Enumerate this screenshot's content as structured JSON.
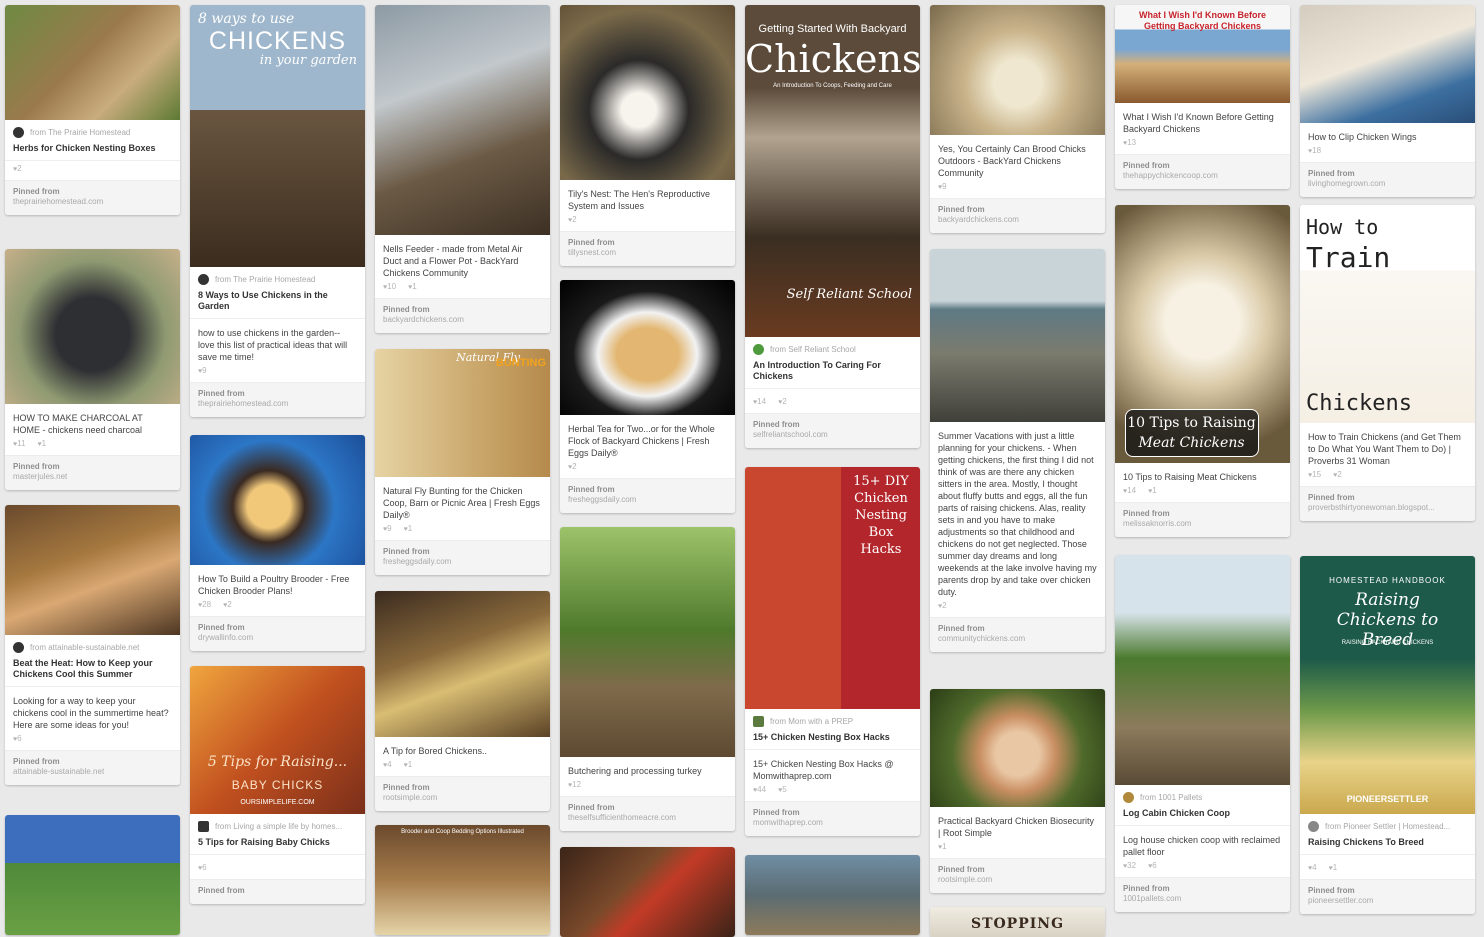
{
  "columns": [
    [
      {
        "h": 115,
        "bg": "linear-gradient(135deg,#6e8a43,#9a7a4c 45%,#c9ac7d 70%,#5d7a33)",
        "from": "from The Prairie Homestead",
        "title": "Herbs for Chicken Nesting Boxes",
        "counts": [
          "2"
        ],
        "pinned_label": "Pinned from",
        "pinned_site": "theprairiehomestead.com"
      },
      {
        "h": 155,
        "bg": "radial-gradient(circle at 50% 55%,#2d2f33 0 30%,#8f9a72 60%,#c6b08a 100%)",
        "desc": "HOW TO MAKE CHARCOAL AT HOME - chickens need charcoal",
        "counts": [
          "11",
          "1"
        ],
        "pinned_label": "Pinned from",
        "pinned_site": "masterjules.net"
      },
      {
        "h": 130,
        "bg": "linear-gradient(160deg,#6a4a2d,#a5783f 40%,#d9a873 60%,#4d3622)",
        "from": "from attainable-sustainable.net",
        "title": "Beat the Heat: How to Keep your Chickens Cool this Summer",
        "desc": "Looking for a way to keep your chickens cool in the summertime heat? Here are some ideas for you!",
        "counts": [
          "6"
        ],
        "pinned_label": "Pinned from",
        "pinned_site": "attainable-sustainable.net"
      },
      {
        "h": 120,
        "bg": "linear-gradient(180deg,#3c6ebd 0 40%,#4f8a3a 40%,#6aa044 100%)",
        "counts": []
      }
    ],
    [
      {
        "h": 260,
        "bg": "linear-gradient(180deg,#9fb7cc 0 40%,#6a5640 40%,#3b2c1e 100%)",
        "overlay": "8 ways to use",
        "overlay2": "CHICKENS",
        "overlay3": "in your garden",
        "from": "from The Prairie Homestead",
        "title": "8 Ways to Use Chickens in the Garden",
        "desc": "how to use chickens in the garden-- love this list of practical ideas that will save me time!",
        "counts": [
          "9"
        ],
        "pinned_label": "Pinned from",
        "pinned_site": "theprairiehomestead.com"
      },
      {
        "h": 130,
        "bg": "radial-gradient(circle at 45% 55%,#f1c87a 0 18%,#3a2a22 30%,#2c76c6 55%,#1c4f9a 100%)",
        "desc": "How To Build a Poultry Brooder - Free Chicken Brooder Plans!",
        "counts": [
          "28",
          "2"
        ],
        "pinned_label": "Pinned from",
        "pinned_site": "drywallinfo.com"
      },
      {
        "h": 148,
        "bg": "linear-gradient(135deg,#f0a63e,#c1501f 50%,#7a2f1a)",
        "overlay": "5 Tips for Raising...",
        "overlay2": "BABY CHICKS",
        "overlay3": "OURSIMPLELIFE.COM",
        "from": "from Living a simple life by homes...",
        "title": "5 Tips for Raising Baby Chicks",
        "counts": [
          "6"
        ],
        "pinned_label": "Pinned from",
        "pinned_site": ""
      }
    ],
    [
      {
        "h": 230,
        "bg": "linear-gradient(160deg,#8d9aa4,#c2c8cc 35%,#6b5a45 65%,#3d3024)",
        "desc": "Nells Feeder - made from Metal Air Duct and a Flower Pot - BackYard Chickens Community",
        "counts": [
          "10",
          "1"
        ],
        "pinned_label": "Pinned from",
        "pinned_site": "backyardchickens.com"
      },
      {
        "h": 128,
        "bg": "linear-gradient(90deg,#e6d3a3,#c9a66a 60%,#b58a4c)",
        "overlay": "Natural Fly",
        "overlay2": "BUNTING",
        "desc": "Natural Fly Bunting for the Chicken Coop, Barn or Picnic Area | Fresh Eggs Daily®",
        "counts": [
          "9",
          "1"
        ],
        "pinned_label": "Pinned from",
        "pinned_site": "fresheggsdaily.com"
      },
      {
        "h": 146,
        "bg": "linear-gradient(160deg,#3b2b1f,#8a6a3c 40%,#d8bd73 60%,#5b4226)",
        "desc": "A Tip for Bored Chickens..",
        "counts": [
          "4",
          "1"
        ],
        "pinned_label": "Pinned from",
        "pinned_site": "rootsimple.com"
      },
      {
        "h": 110,
        "bg": "linear-gradient(180deg,#6b4a2d,#a57b4a 50%,#e5d4a8)",
        "overlay": "Brooder and Coop Bedding Options Illustrated",
        "counts": []
      }
    ],
    [
      {
        "h": 175,
        "bg": "radial-gradient(circle at 45% 60%,#f7f4ee 0 12%,#2b2a29 35%,#7a6a4a 70%,#5d4a32)",
        "desc": "Tily's Nest: The Hen's Reproductive System and Issues",
        "counts": [
          "2"
        ],
        "pinned_label": "Pinned from",
        "pinned_site": "tillysnest.com"
      },
      {
        "h": 135,
        "bg": "radial-gradient(ellipse at 50% 55%,#e3b772 0 25%,#f2f2f2 40%,#1a1a1a 60%,#000)",
        "desc": "Herbal Tea for Two...or for the Whole Flock of Backyard Chickens | Fresh Eggs Daily®",
        "counts": [
          "2"
        ],
        "pinned_label": "Pinned from",
        "pinned_site": "fresheggsdaily.com"
      },
      {
        "h": 230,
        "bg": "linear-gradient(180deg,#9dc36a,#4f7a2c 45%,#7f6a4b 70%,#5d4a31)",
        "desc": "Butchering and processing turkey",
        "counts": [
          "12"
        ],
        "pinned_label": "Pinned from",
        "pinned_site": "theselfsufficienthomeacre.com"
      },
      {
        "h": 90,
        "bg": "linear-gradient(135deg,#3a2418,#7a4a2b 40%,#c23b26 55%,#3a2418)",
        "counts": []
      }
    ],
    [
      {
        "h": 330,
        "bg": "linear-gradient(180deg,#5c4b3a 0 25%,#b2a390 40%,#3a2e22 70%,#6a3b20)",
        "overlay": "Getting Started With Backyard",
        "overlay2": "Chickens",
        "overlay3": "An Introduction To Coops, Feeding and Care",
        "overlay4": "Self Reliant School",
        "from": "from Self Reliant School",
        "title": "An Introduction To Caring For Chickens",
        "counts": [
          "14",
          "2"
        ],
        "pinned_label": "Pinned from",
        "pinned_site": "selfreliantschool.com"
      },
      {
        "h": 240,
        "bg": "linear-gradient(90deg,#c9462f 0 55%,#b3262b 55%),linear-gradient(180deg,#e0e0e0,#c2a98b)",
        "overlay": "15+ DIY Chicken Nesting Box Hacks",
        "from": "from Mom with a PREP",
        "title": "15+ Chicken Nesting Box Hacks",
        "desc": "15+ Chicken Nesting Box Hacks @ Momwithaprep.com",
        "counts": [
          "44",
          "5"
        ],
        "pinned_label": "Pinned from",
        "pinned_site": "momwithaprep.com"
      },
      {
        "h": 80,
        "bg": "linear-gradient(180deg,#6f8ea4,#5b6c72 50%,#8d7a5b)",
        "counts": []
      }
    ],
    [
      {
        "h": 100,
        "bg": "radial-gradient(circle at 50% 60%,#efe7cf 0 20%,#c9b48b 45%,#7a6a4c 100%)",
        "desc": "Yes, You Certainly Can Brood Chicks Outdoors - BackYard Chickens Community",
        "counts": [
          "9"
        ],
        "pinned_label": "Pinned from",
        "pinned_site": "backyardchickens.com"
      },
      {
        "h": 173,
        "bg": "linear-gradient(180deg,#c9d4d8 0 30%,#5e7a85 35%,#7b7b6e 60%,#40403a)",
        "desc": "Summer Vacations with just a little planning for your chickens. - When getting chickens, the first thing I did not think of was are there any chicken sitters in the area. Mostly, I thought about fluffy butts and eggs, all the fun parts of raising chickens. Alas, reality sets in and you have to make adjustments so that childhood and chickens do not get neglected. Those summer day dreams and long weekends at the lake involve having my parents drop by and take over chicken duty.",
        "counts": [
          "2"
        ],
        "pinned_label": "Pinned from",
        "pinned_site": "communitychickens.com"
      },
      {
        "h": 118,
        "bg": "radial-gradient(circle at 50% 55%,#e9c7a4 0 20%,#c98e62 35%,#4f6a2b 60%,#2b3d16)",
        "desc": "Practical Backyard Chicken Biosecurity | Root Simple",
        "counts": [
          "1"
        ],
        "pinned_label": "Pinned from",
        "pinned_site": "rootsimple.com"
      },
      {
        "h": 30,
        "bg": "linear-gradient(180deg,#f0ece2,#d8d2c4)",
        "overlay": "STOPPING",
        "counts": []
      }
    ],
    [
      {
        "h": 98,
        "bg": "linear-gradient(180deg,#f6f6f6 0 25%,#7aa6d2 25%,#7aa6d2 45%,#d4b07a 60%,#8a5a2e)",
        "overlay": "What I Wish I'd Known Before Getting Backyard Chickens",
        "desc": "What I Wish I'd Known Before Getting Backyard Chickens",
        "counts": [
          "13"
        ],
        "pinned_label": "Pinned from",
        "pinned_site": "thehappychickencoop.com"
      },
      {
        "h": 258,
        "bg": "radial-gradient(circle at 50% 45%,#f7f1e3 0 22%,#d9c9a6 40%,#6a5a3c 80%)",
        "overlay": "10 Tips to Raising",
        "overlay2": "Meat Chickens",
        "desc": "10 Tips to Raising Meat Chickens",
        "counts": [
          "14",
          "1"
        ],
        "pinned_label": "Pinned from",
        "pinned_site": "melissaknorris.com"
      },
      {
        "h": 230,
        "bg": "linear-gradient(180deg,#d7e3ea 0 25%,#4b7a2e 45%,#8c7b5c 75%,#5a4b36)",
        "from": "from 1001 Pallets",
        "title": "Log Cabin Chicken Coop",
        "desc": "Log house chicken coop with reclaimed pallet floor",
        "counts": [
          "32",
          "6"
        ],
        "pinned_label": "Pinned from",
        "pinned_site": "1001pallets.com"
      }
    ],
    [
      {
        "h": 118,
        "bg": "linear-gradient(160deg,#d4cdbf,#efe8da 45%,#3c6fa0 75%,#2a4e78)",
        "desc": "How to Clip Chicken Wings",
        "counts": [
          "18"
        ],
        "pinned_label": "Pinned from",
        "pinned_site": "livinghomegrown.com"
      },
      {
        "h": 212,
        "bg": "linear-gradient(180deg,#ffffff 0 30%,#faf7f2 30%,#f5efe4 100%)",
        "overlay": "How to",
        "overlay2": "Train",
        "overlay3": "Chickens",
        "desc": "How to Train Chickens (and Get Them to Do What You Want Them to Do) | Proverbs 31 Woman",
        "counts": [
          "15",
          "2"
        ],
        "pinned_label": "Pinned from",
        "pinned_site": "proverbsthirtyonewoman.blogspot..."
      },
      {
        "h": 250,
        "bg": "linear-gradient(180deg,#1d5a49 0 40%,#6f9a4a 60%,#e8d389 80%,#caa84d)",
        "overlay": "HOMESTEAD HANDBOOK",
        "overlay2": "Raising Chickens to Breed",
        "overlay3": "RAISING BACKYARD CHICKENS",
        "overlay4": "PIONEERSETTLER",
        "from": "from Pioneer Settler | Homestead...",
        "title": "Raising Chickens To Breed",
        "counts": [
          "4",
          "1"
        ],
        "pinned_label": "Pinned from",
        "pinned_site": "pioneersettler.com"
      }
    ]
  ],
  "colors": {
    "page_bg": "#e9e9e9",
    "card": "#ffffff",
    "accent_red": "#c8232c"
  }
}
